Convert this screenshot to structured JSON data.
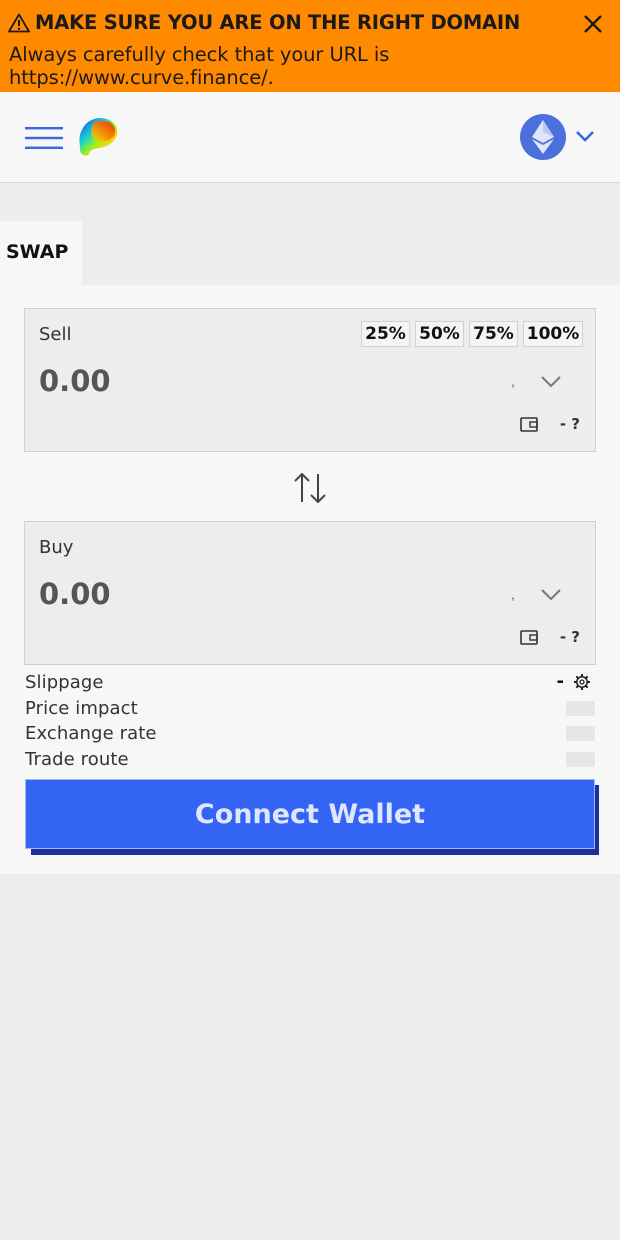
{
  "banner": {
    "title": "MAKE SURE YOU ARE ON THE RIGHT DOMAIN",
    "message": "Always carefully check that your URL is https://www.curve.finance/.",
    "icons": {
      "warning": "warning-triangle-icon",
      "close": "close-icon"
    },
    "color": "#ff8a00"
  },
  "header": {
    "icons": {
      "menu": "hamburger-menu-icon",
      "logo": "curve-logo",
      "network": "ethereum-icon",
      "chevron": "chevron-down-icon"
    }
  },
  "tabs": [
    {
      "label": "SWAP",
      "active": true
    }
  ],
  "sell": {
    "label": "Sell",
    "amount_placeholder": "0.00",
    "percent_buttons": [
      "25%",
      "50%",
      "75%",
      "100%"
    ],
    "balance": "- ?",
    "dot": ","
  },
  "buy": {
    "label": "Buy",
    "amount_placeholder": "0.00",
    "balance": "- ?",
    "dot": ","
  },
  "details": {
    "slippage": {
      "label": "Slippage",
      "value": "-"
    },
    "price_impact": {
      "label": "Price impact"
    },
    "exchange_rate": {
      "label": "Exchange rate"
    },
    "trade_route": {
      "label": "Trade route"
    }
  },
  "connect_button": {
    "label": "Connect Wallet",
    "color": "#3464f4"
  },
  "colors": {
    "accent": "#3464f4",
    "network": "#4c6fdc",
    "background": "#eeedeb",
    "panel": "#f7f7f7"
  }
}
